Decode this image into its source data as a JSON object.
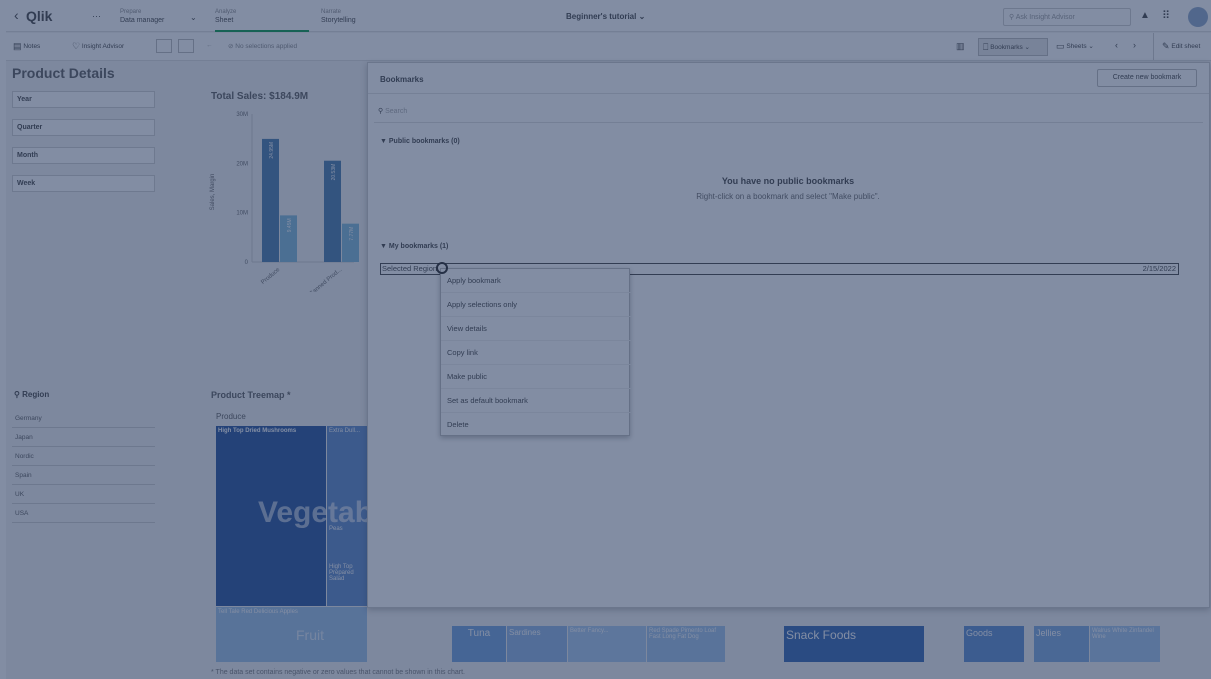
{
  "topbar": {
    "back_glyph": "‹",
    "logo": "Qlik",
    "more": "···",
    "tabs": [
      {
        "label": "Prepare",
        "value": "Data manager"
      },
      {
        "label": "Analyze",
        "value": "Sheet"
      },
      {
        "label": "Narrate",
        "value": "Storytelling"
      }
    ],
    "app_title": "Beginner's tutorial",
    "search_placeholder": "Ask Insight Advisor"
  },
  "toolbar": {
    "notes": "Notes",
    "insight_advisor": "Insight Advisor",
    "no_selections": "No selections applied",
    "bookmarks": "Bookmarks",
    "sheets": "Sheets",
    "edit_sheet": "Edit sheet"
  },
  "sheet": {
    "title": "Product Details",
    "filters": [
      "Year",
      "Quarter",
      "Month",
      "Week"
    ],
    "region_title": "Region",
    "regions": [
      "Germany",
      "Japan",
      "Nordic",
      "Spain",
      "UK",
      "USA"
    ],
    "treemap_title": "Product Treemap *",
    "treemap_header": "Produce",
    "treemap_cells": [
      {
        "label": "High Top Dried Mushrooms"
      },
      {
        "label": "Extra Dull..."
      },
      {
        "label": "Peas"
      },
      {
        "label": "High Top Prepared Salad"
      },
      {
        "label": "Tell Tale Red Delicious Apples"
      },
      {
        "label": "Tuna"
      },
      {
        "label": "Sardines"
      },
      {
        "label": "Better Fancy..."
      },
      {
        "label": "Red Spade Pimento Loaf"
      },
      {
        "label": "Fast Long Fat Dog"
      },
      {
        "label": "Goods"
      },
      {
        "label": "Jellies"
      },
      {
        "label": "Walrus White Zinfandel Wine"
      }
    ],
    "treemap_big_labels": [
      "Vegetables",
      "Fruit",
      "Snack Foods"
    ],
    "footnote": "* The data set contains negative or zero values that cannot be shown in this chart."
  },
  "chart_data": {
    "type": "bar",
    "title": "Total Sales: $184.9M",
    "ylabel": "Sales, Margin",
    "categories": [
      "Produce",
      "Canned Prod..."
    ],
    "series": [
      {
        "values": [
          24.95,
          20.53
        ],
        "labels": [
          "24.95M",
          "20.53M"
        ],
        "color": "#4477aa"
      },
      {
        "values": [
          9.45,
          7.77
        ],
        "labels": [
          "9.45M",
          "7.77M"
        ],
        "color": "#7db8da"
      }
    ],
    "yticks": [
      "0",
      "10M",
      "20M",
      "30M"
    ],
    "ylim": [
      0,
      30
    ]
  },
  "bookmarks": {
    "title": "Bookmarks",
    "create_button": "Create new bookmark",
    "search_placeholder": "Search",
    "public_header": "Public bookmarks (0)",
    "empty_title": "You have no public bookmarks",
    "empty_desc": "Right-click on a bookmark and select \"Make public\".",
    "my_header": "My bookmarks (1)",
    "items": [
      {
        "name": "Selected Region",
        "date": "2/15/2022"
      }
    ]
  },
  "context_menu": {
    "items": [
      "Apply bookmark",
      "Apply selections only",
      "View details",
      "Copy link",
      "Make public",
      "Set as default bookmark",
      "Delete"
    ]
  },
  "colors": {
    "accent": "#009845",
    "overlay": "#28406a",
    "bar_dark": "#4477aa",
    "bar_light": "#7db8da"
  }
}
